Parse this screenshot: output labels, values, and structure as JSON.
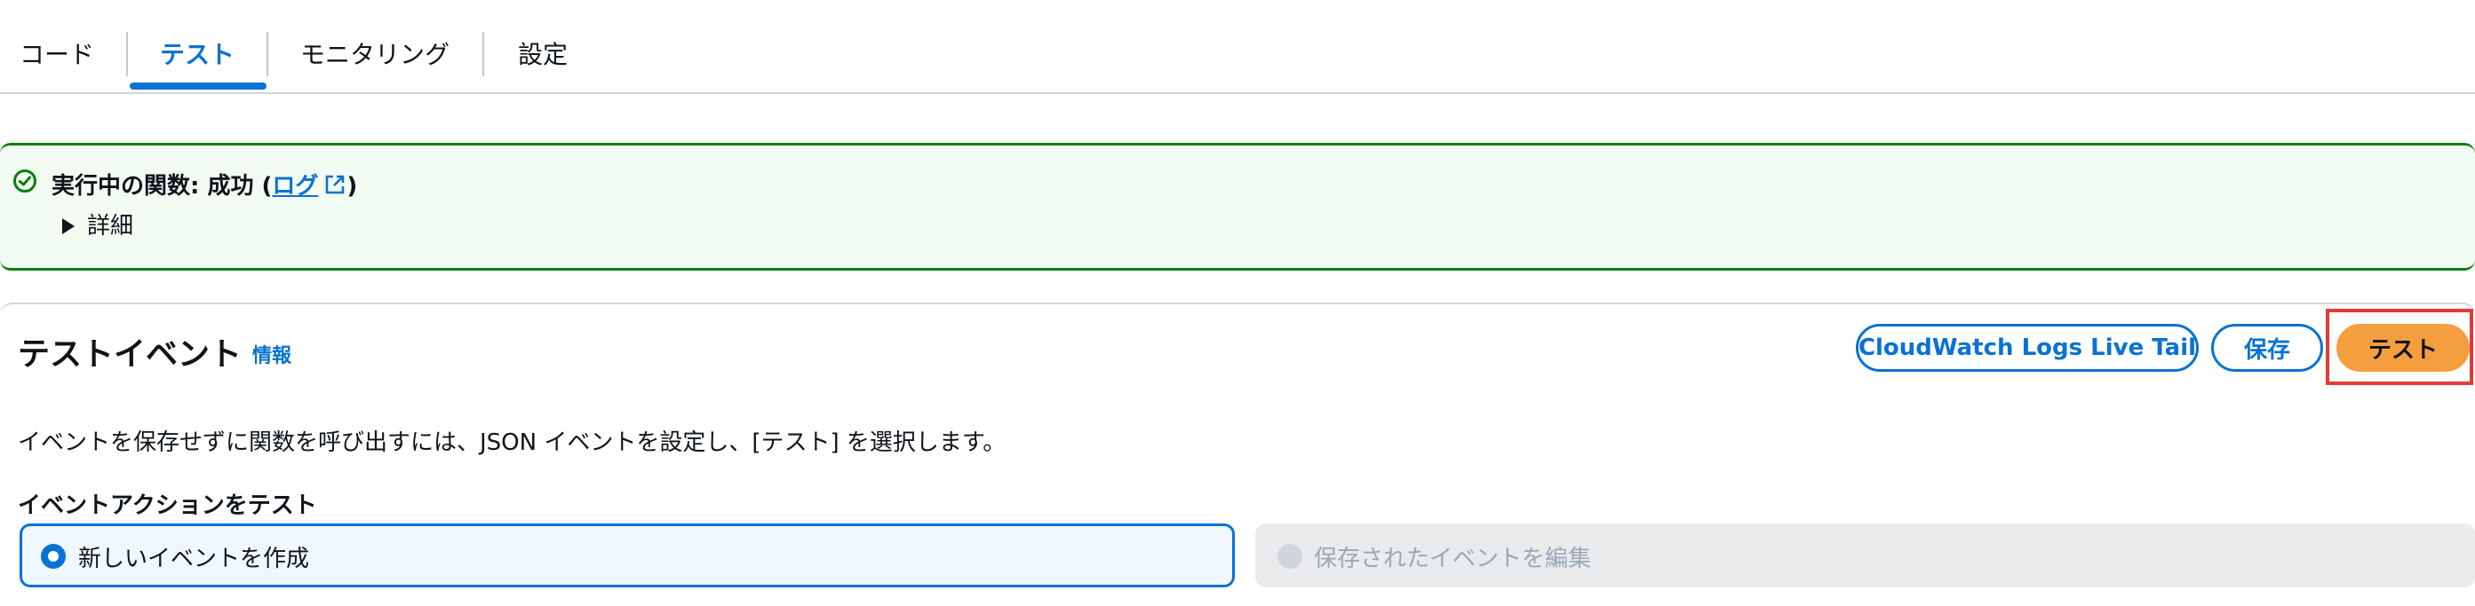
{
  "tabs": [
    {
      "label": "コード",
      "active": false
    },
    {
      "label": "テスト",
      "active": true
    },
    {
      "label": "モニタリング",
      "active": false
    },
    {
      "label": "設定",
      "active": false
    }
  ],
  "alert": {
    "status": "success",
    "title_prefix": "実行中の関数: 成功 (",
    "log_link": "ログ",
    "title_suffix": ")",
    "details_label": "詳細",
    "icon": "check-circle-icon"
  },
  "test_event": {
    "title": "テストイベント",
    "info_link": "情報",
    "buttons": {
      "live_tail": "CloudWatch Logs Live Tail",
      "save": "保存",
      "test": "テスト"
    },
    "description": "イベントを保存せずに関数を呼び出すには、JSON イベントを設定し、[テスト] を選択します。",
    "action_label": "イベントアクションをテスト",
    "options": [
      {
        "label": "新しいイベントを作成",
        "selected": true,
        "disabled": false
      },
      {
        "label": "保存されたイベントを編集",
        "selected": false,
        "disabled": true
      }
    ]
  },
  "colors": {
    "accent": "#0972d3",
    "success": "#037f0c",
    "success_bg": "#f2fcf3",
    "primary_button": "#f59e3f",
    "highlight": "#e53935"
  }
}
